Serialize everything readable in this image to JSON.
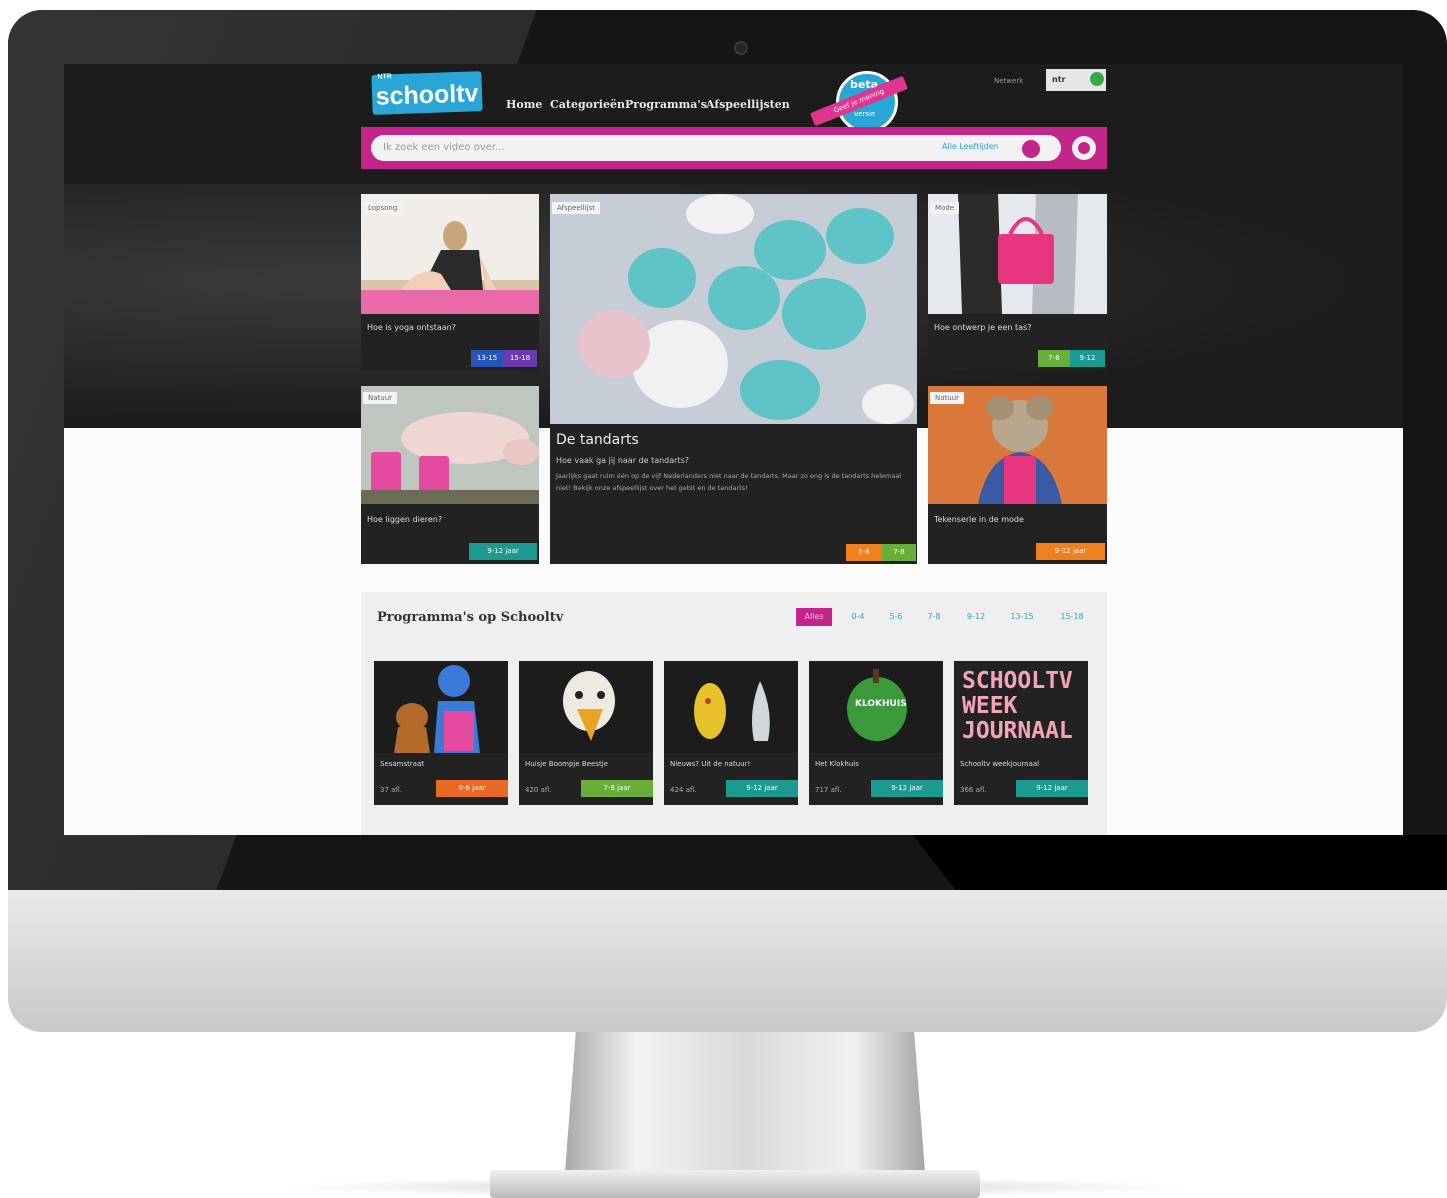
{
  "site": {
    "logo_small": "NTR",
    "logo": "schooltv",
    "nav": [
      "Home",
      "Categorieën",
      "Programma's",
      "Afspeellijsten"
    ],
    "beta": {
      "word": "beta",
      "ribbon": "Geef je mening",
      "versie": "versie"
    },
    "network": "Netwerk",
    "broadcaster": "ntr"
  },
  "search": {
    "placeholder": "Ik zoek een video over...",
    "age_filter": "Alle Leeftijden"
  },
  "featured": {
    "left_top": {
      "tag": "Lopsong",
      "title": "Hoe is yoga ontstaan?",
      "badges": [
        "13-15",
        "15-18"
      ]
    },
    "left_bottom": {
      "tag": "Natuur",
      "title": "Hoe liggen dieren?",
      "badges": [
        "9-12 jaar"
      ]
    },
    "center": {
      "tag": "Afspeellijst",
      "title": "De tandarts",
      "subtitle": "Hoe vaak ga jij naar de tandarts?",
      "description": "Jaarlijks gaat ruim één op de vijf Nederlanders niet naar de tandarts. Maar zo eng is de tandarts helemaal niet! Bekijk onze afspeellijst over het gebit en de tandarts!",
      "badges": [
        "5-6",
        "7-8"
      ]
    },
    "right_top": {
      "tag": "Mode",
      "title": "Hoe ontwerp je een tas?",
      "badges": [
        "7-8",
        "9-12"
      ]
    },
    "right_bottom": {
      "tag": "Natuur",
      "title": "Tekenserie in de mode",
      "badges": [
        "9-12 jaar"
      ]
    }
  },
  "programmes": {
    "heading": "Programma's op Schooltv",
    "filters": [
      "Alles",
      "0-4",
      "5-6",
      "7-8",
      "9-12",
      "13-15",
      "15-18"
    ],
    "items": [
      {
        "name": "Sesamstraat",
        "views": "37 afl.",
        "age": "0-6 jaar",
        "age_color": "#e86a25"
      },
      {
        "name": "Huisje Boompje Beestje",
        "views": "420 afl.",
        "age": "7-8 jaar",
        "age_color": "#6aae3a"
      },
      {
        "name": "Nieuws? Uit de natuur!",
        "views": "424 afl.",
        "age": "9-12 jaar",
        "age_color": "#1c9a8f"
      },
      {
        "name": "Het Klokhuis",
        "views": "717 afl.",
        "age": "9-12 jaar",
        "age_color": "#1c9a8f"
      },
      {
        "name": "Schooltv weekjournaal",
        "views": "366 afl.",
        "age": "9-12 jaar",
        "age_color": "#1c9a8f"
      }
    ],
    "logo_text": [
      "SCHOOLTV",
      "WEEK",
      "JOURNAAL"
    ],
    "klokhuis_text": "KLOKHUIS"
  }
}
